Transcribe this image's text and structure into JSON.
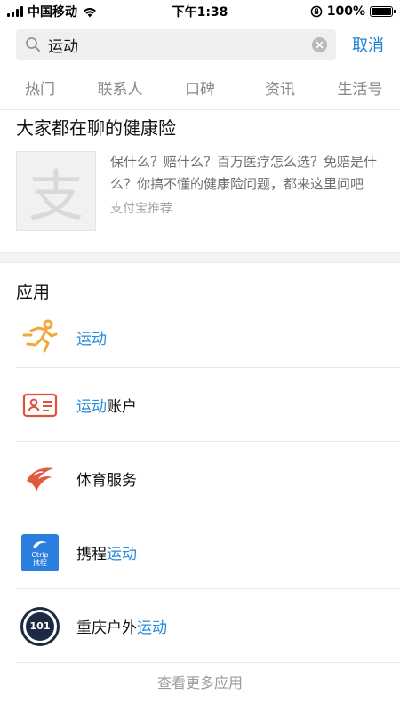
{
  "status": {
    "carrier": "中国移动",
    "time": "下午1:38",
    "battery": "100%"
  },
  "search": {
    "query": "运动",
    "cancel_label": "取消"
  },
  "tabs": [
    {
      "label": "热门"
    },
    {
      "label": "联系人"
    },
    {
      "label": "口碑"
    },
    {
      "label": "资讯"
    },
    {
      "label": "生活号"
    }
  ],
  "article": {
    "title": "大家都在聊的健康险",
    "description": "保什么？赔什么？百万医疗怎么选？免赔是什么？你搞不懂的健康险问题，都来这里问吧",
    "source": "支付宝推荐",
    "thumb_glyph": "支"
  },
  "apps": {
    "heading": "应用",
    "items": [
      {
        "pre": "",
        "hl": "运动",
        "post": "",
        "icon": "running-person-icon"
      },
      {
        "pre": "",
        "hl": "运动",
        "post": "账户",
        "icon": "id-card-icon"
      },
      {
        "pre": "体育服务",
        "hl": "",
        "post": "",
        "icon": "sports-service-icon"
      },
      {
        "pre": "携程",
        "hl": "运动",
        "post": "",
        "icon": "ctrip-logo-icon",
        "icon_text_top": "Ctrip",
        "icon_text_bottom": "携程"
      },
      {
        "pre": "重庆户外",
        "hl": "运动",
        "post": "",
        "icon": "outdoor-badge-icon",
        "icon_text": "101"
      }
    ],
    "more_label": "查看更多应用"
  },
  "colors": {
    "accent": "#1f82d6",
    "highlight": "#2b8ad8",
    "orange": "#f0a83a",
    "red": "#e0503c"
  }
}
